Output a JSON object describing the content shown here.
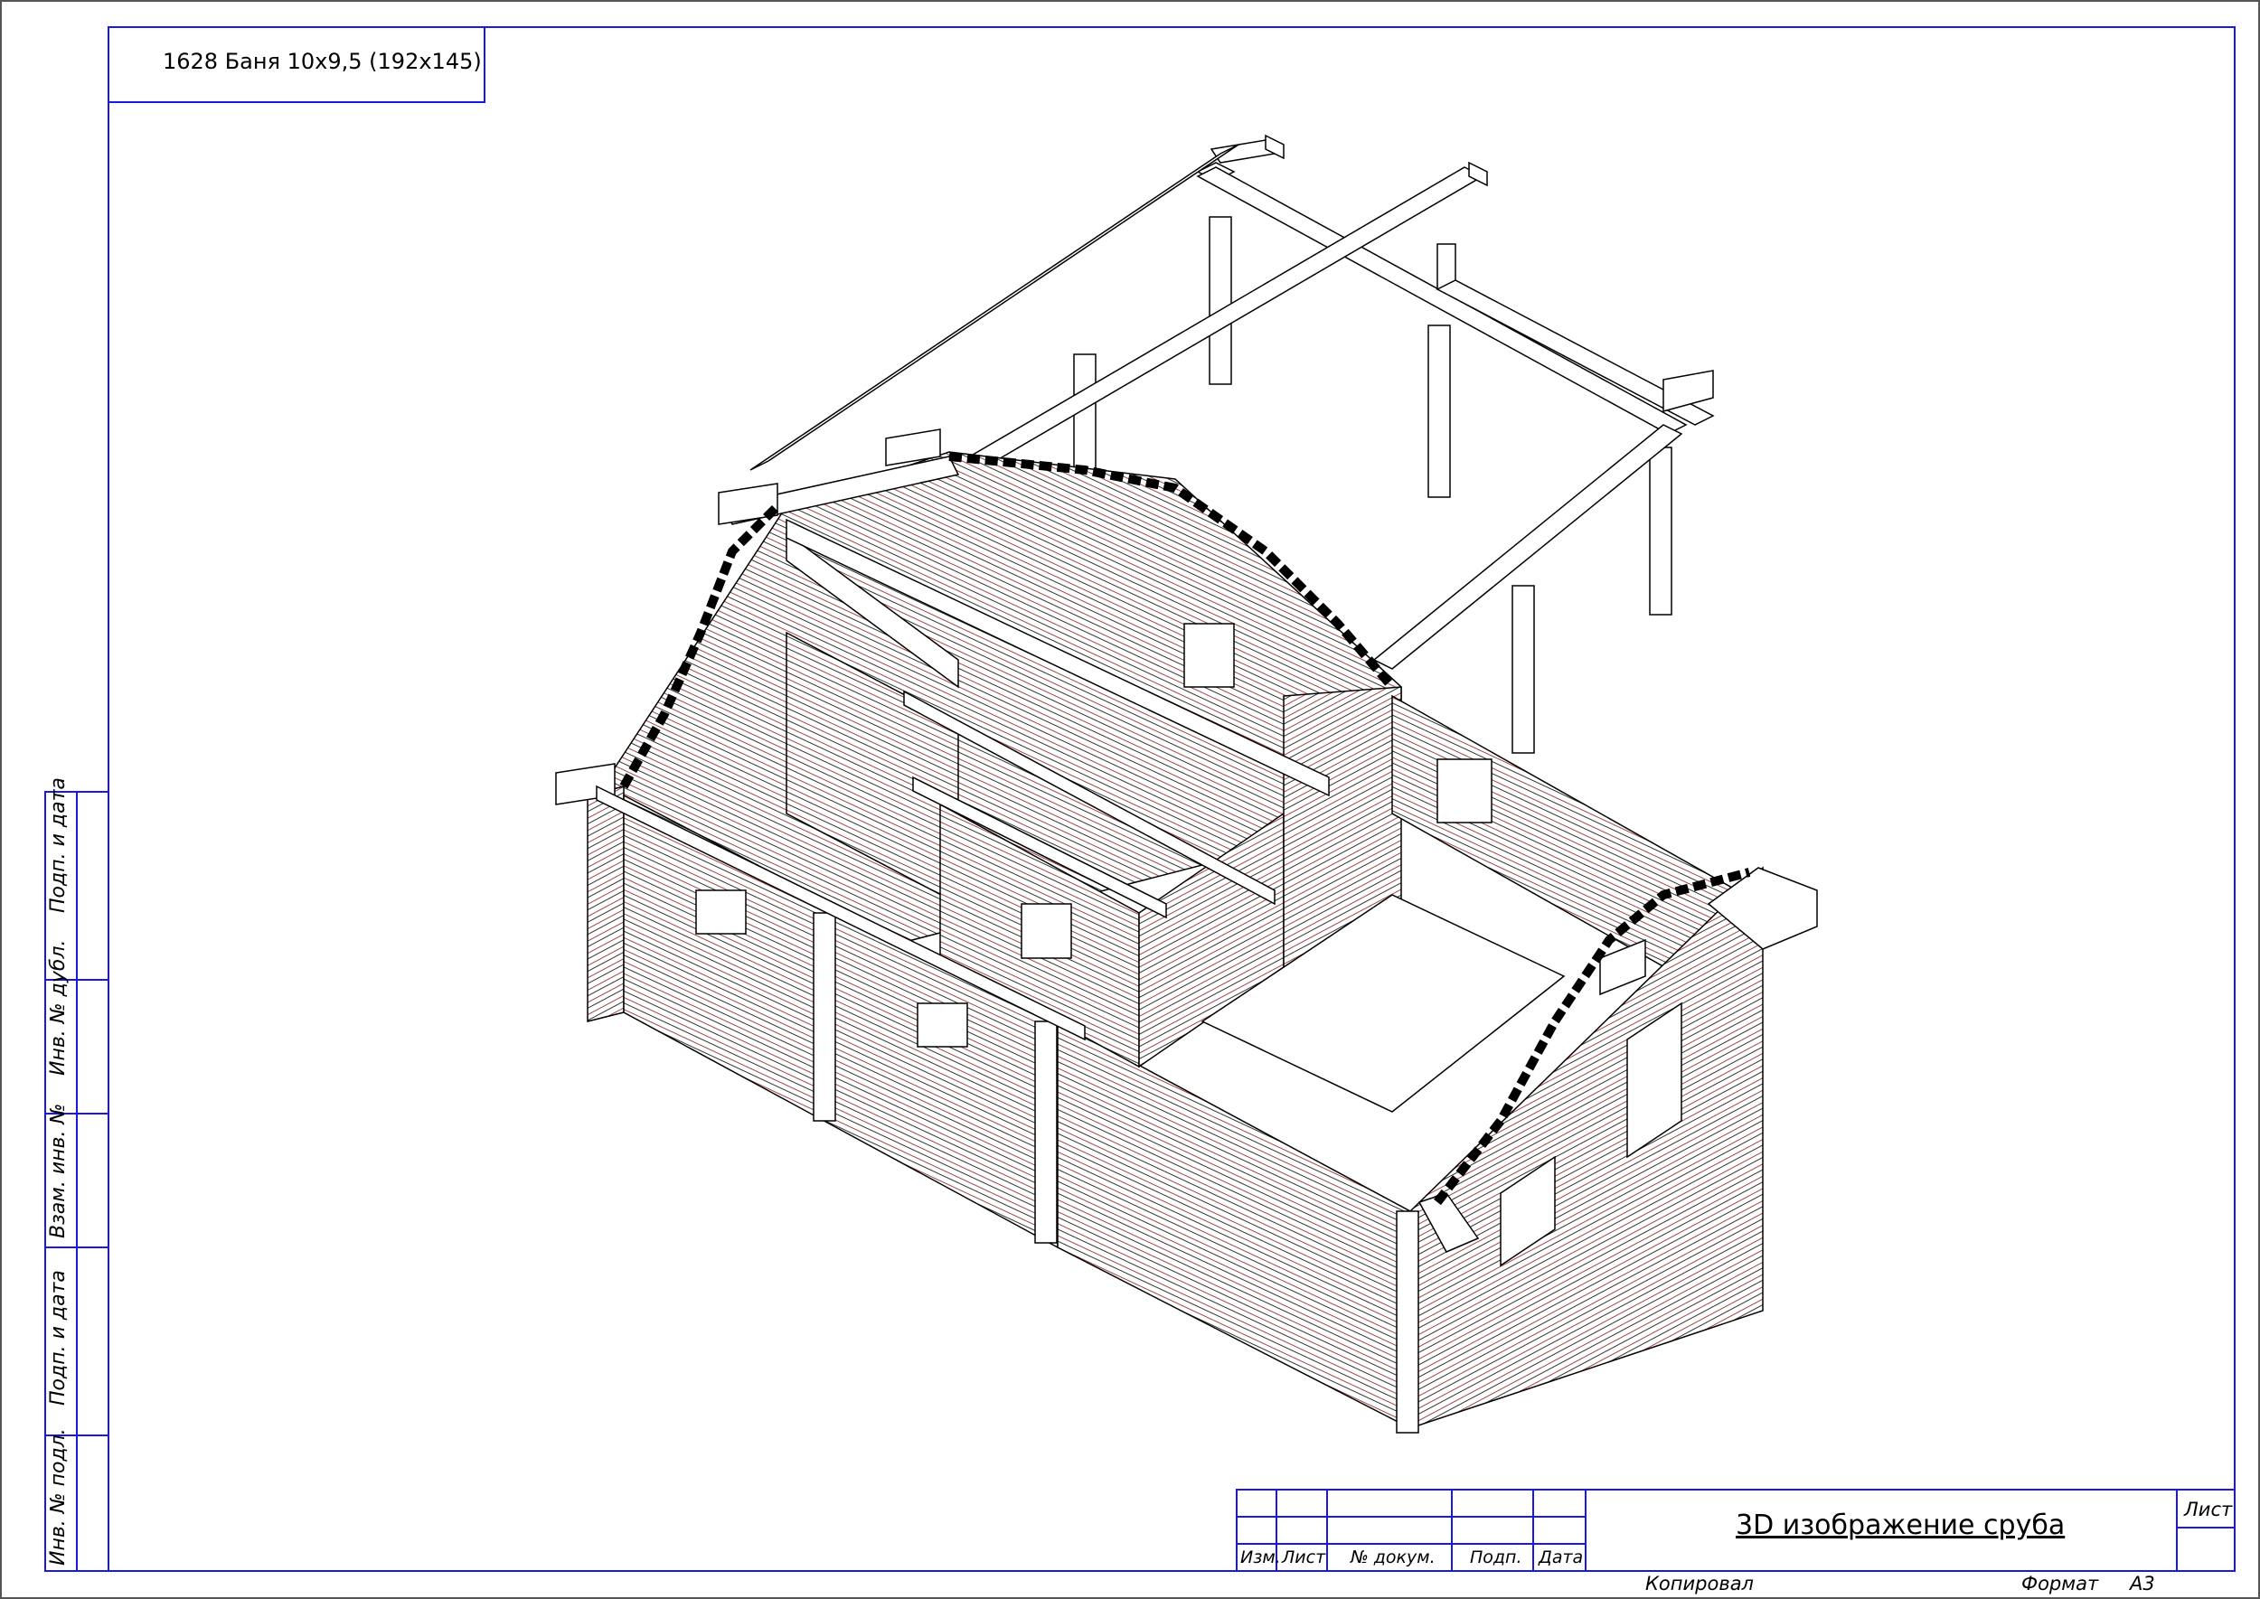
{
  "title_box": {
    "code": "1628 Баня 10х9,5 (192х145)"
  },
  "side_stamp": {
    "labels": [
      "Подп. и дата",
      "Инв. № дубл.",
      "Взам. инв. №",
      "Подп. и дата",
      "Инв. № подл."
    ]
  },
  "title_block": {
    "headers": [
      "Изм.",
      "Лист",
      "№ докум.",
      "Подп.",
      "Дата"
    ],
    "drawing_title": "3D изображение сруба",
    "sheet_label": "Лист",
    "copied": "Копировал",
    "format_label": "Формат",
    "format_value": "А3"
  },
  "colors": {
    "frame": "#1a1adf",
    "log_lines": "#8b1a1a",
    "outline": "#000000"
  }
}
